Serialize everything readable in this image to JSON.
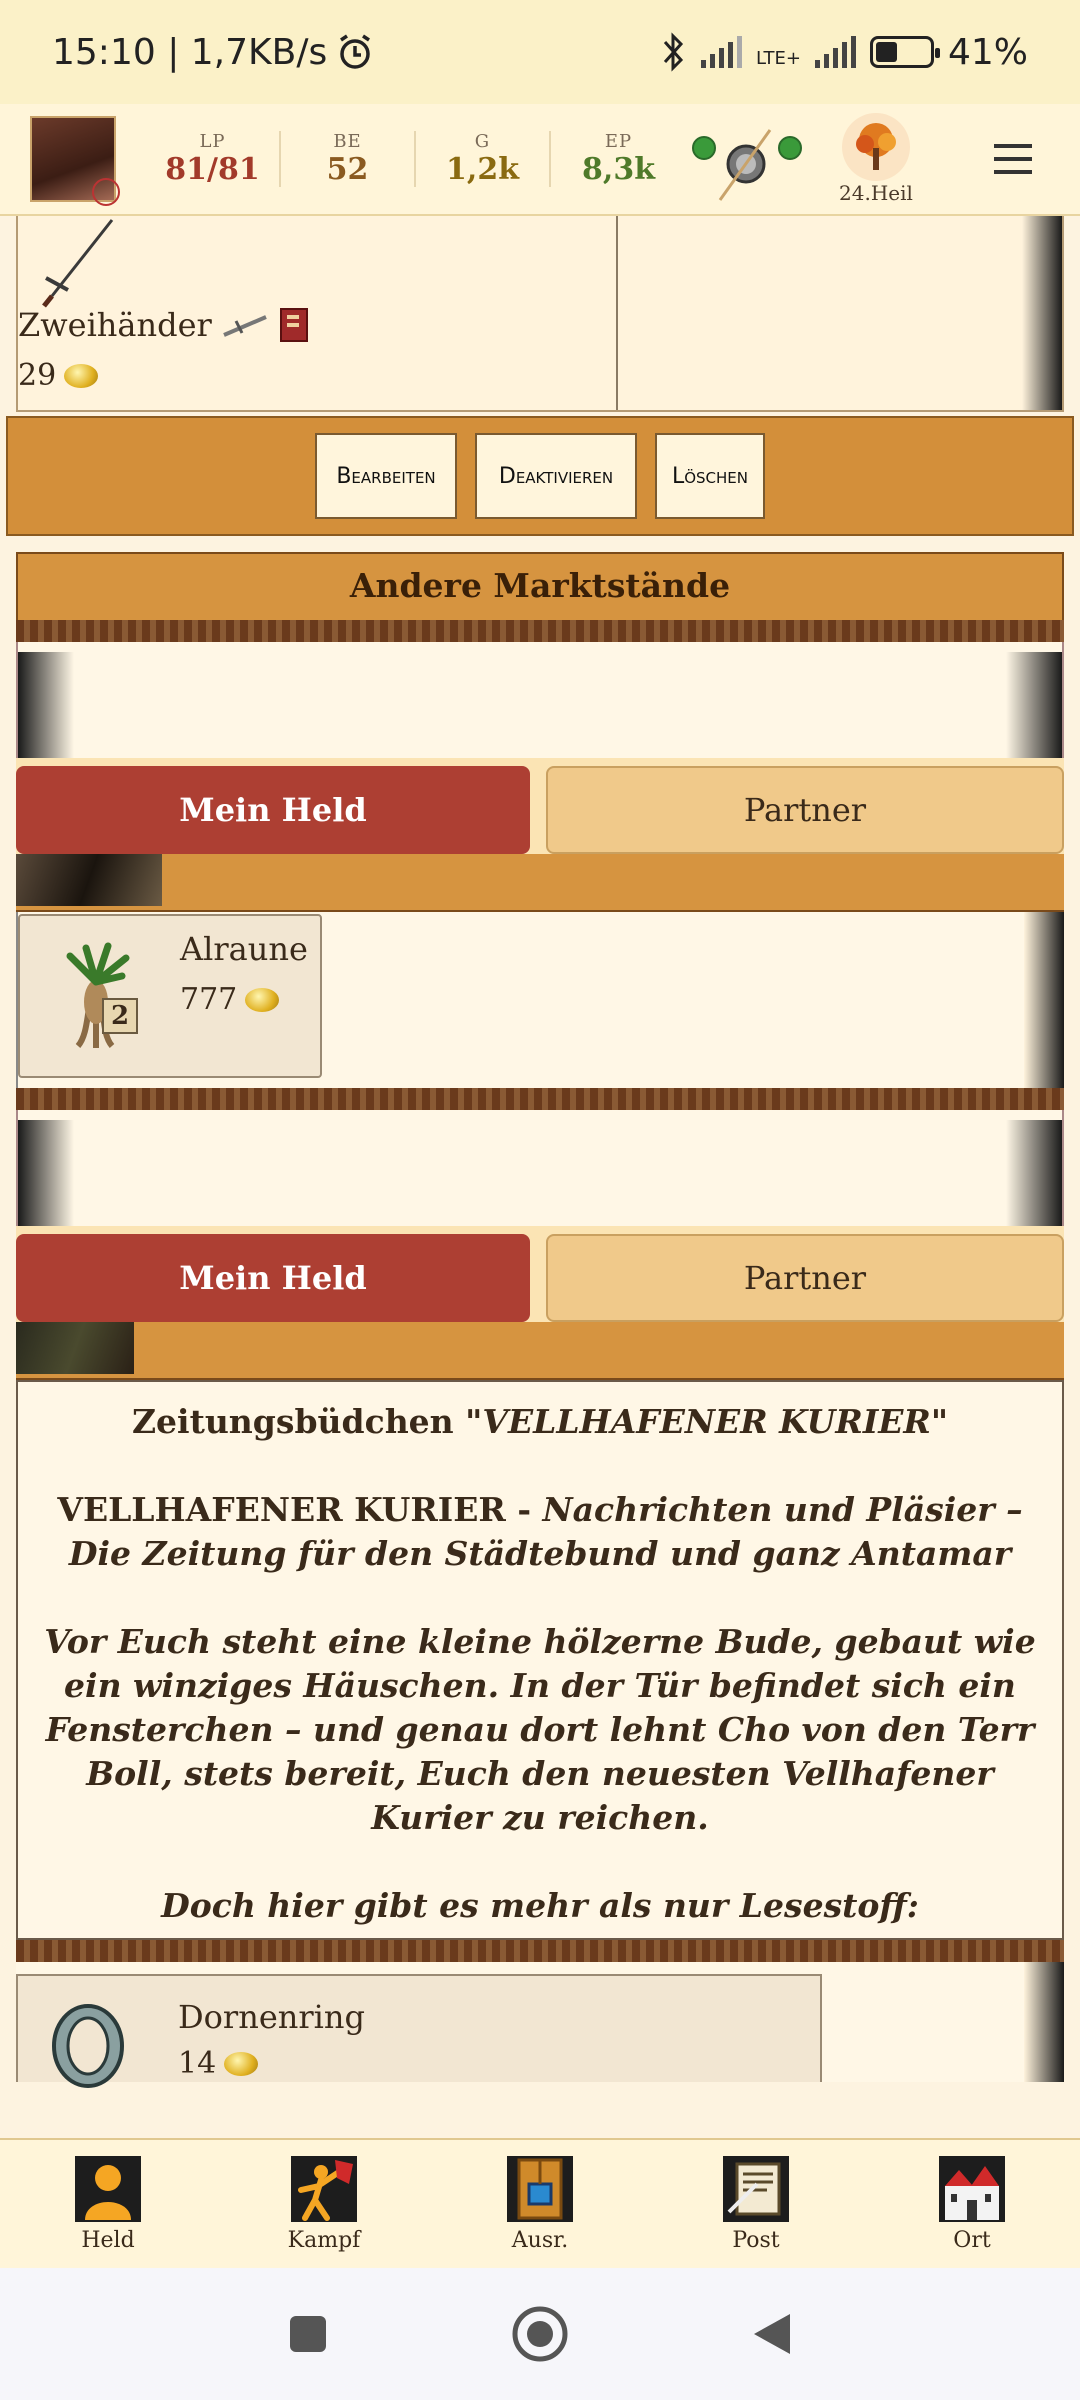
{
  "statusbar": {
    "time": "15:10 | 1,7KB/s",
    "battery": "41%",
    "battery_level": 0.41,
    "network": "LTE+"
  },
  "hero": {
    "stats": [
      {
        "label": "LP",
        "value": "81/81"
      },
      {
        "label": "BE",
        "value": "52"
      },
      {
        "label": "G",
        "value": "1,2k"
      },
      {
        "label": "EP",
        "value": "8,3k"
      }
    ],
    "date": "24.Heil"
  },
  "item": {
    "name": "Zweihänder",
    "price": "29"
  },
  "actions": {
    "edit": "Bearbeiten",
    "deactivate": "Deaktivieren",
    "delete": "Löschen"
  },
  "section": {
    "title": "Andere Marktstände"
  },
  "tabs": {
    "hero": "Mein Held",
    "partner": "Partner"
  },
  "stall1": {
    "item_name": "Alraune",
    "item_price": "777",
    "item_count": "2"
  },
  "news": {
    "heading_prefix": "Zeitungsbüdchen \"",
    "heading_name": "VELLHAFENER KURIER",
    "heading_suffix": "\"",
    "paper_name": "VELLHAFENER KURIER - ",
    "paper_tagline": "Nachrichten und Pläsier – Die Zeitung für den Städtebund und ganz Antamar",
    "description": "Vor Euch steht eine kleine hölzerne Bude, gebaut wie ein winziges Häuschen. In der Tür befindet sich ein Fensterchen – und genau dort lehnt Cho von den Terr Boll, stets bereit, Euch den neuesten Vellhafener Kurier zu reichen.",
    "more": "Doch hier gibt es mehr als nur Lesestoff:"
  },
  "stall2": {
    "item_name": "Dornenring",
    "item_price": "14"
  },
  "bottomnav": [
    {
      "label": "Held",
      "icon": "hero-icon"
    },
    {
      "label": "Kampf",
      "icon": "fight-icon"
    },
    {
      "label": "Ausr.",
      "icon": "equipment-icon"
    },
    {
      "label": "Post",
      "icon": "mail-icon"
    },
    {
      "label": "Ort",
      "icon": "town-icon"
    }
  ]
}
